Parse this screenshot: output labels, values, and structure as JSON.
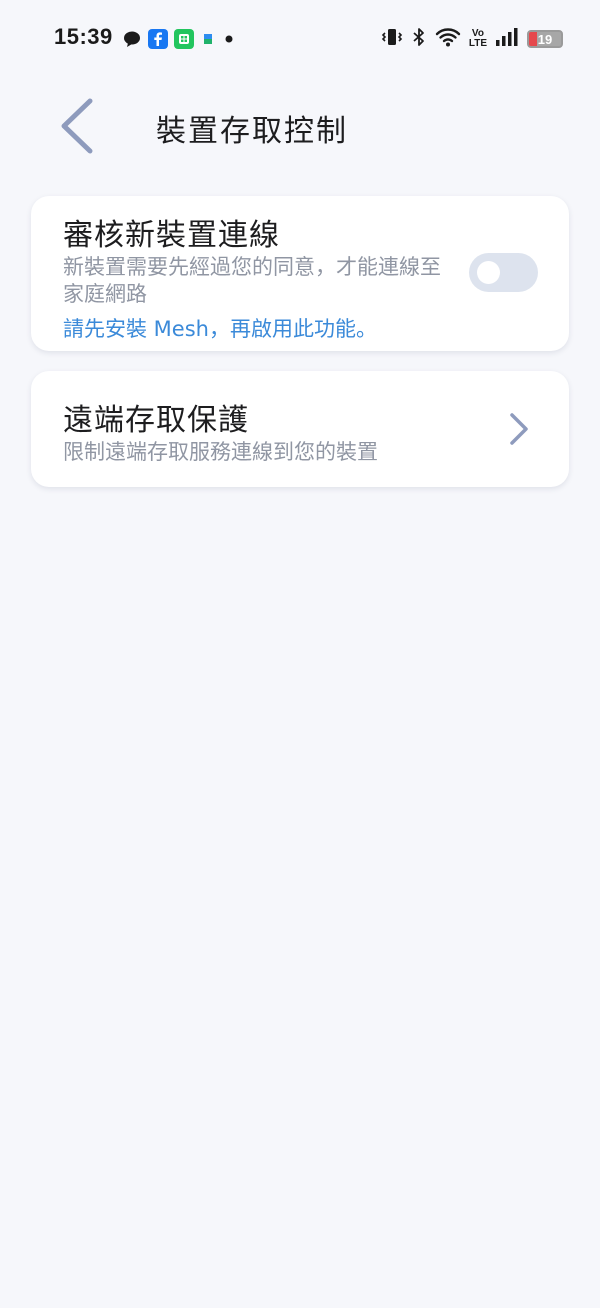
{
  "status_bar": {
    "time": "15:39",
    "battery_level": "19",
    "network_label_top": "Vo",
    "network_label_bottom": "LTE",
    "notification_icons": [
      "chat-bubble-icon",
      "facebook-icon",
      "line-app-icon",
      "app-icon",
      "more-dot-icon"
    ],
    "system_icons": [
      "vibrate-icon",
      "bluetooth-icon",
      "wifi-icon",
      "volte-icon",
      "signal-icon",
      "battery-icon"
    ]
  },
  "header": {
    "title": "裝置存取控制",
    "back_icon": "chevron-left-icon"
  },
  "cards": [
    {
      "title": "審核新裝置連線",
      "description": "新裝置需要先經過您的同意，才能連線至家庭網路",
      "link": "請先安裝 Mesh，再啟用此功能。",
      "toggle_on": false
    },
    {
      "title": "遠端存取保護",
      "description": "限制遠端存取服務連線到您的裝置",
      "icon": "chevron-right-icon"
    }
  ],
  "colors": {
    "background": "#f6f7fb",
    "card": "#ffffff",
    "link": "#3b8ad9",
    "secondary_text": "#9096a3",
    "toggle_off": "#dde3ee",
    "accent_icon": "#8e9bbd",
    "battery_low": "#e5484d"
  }
}
